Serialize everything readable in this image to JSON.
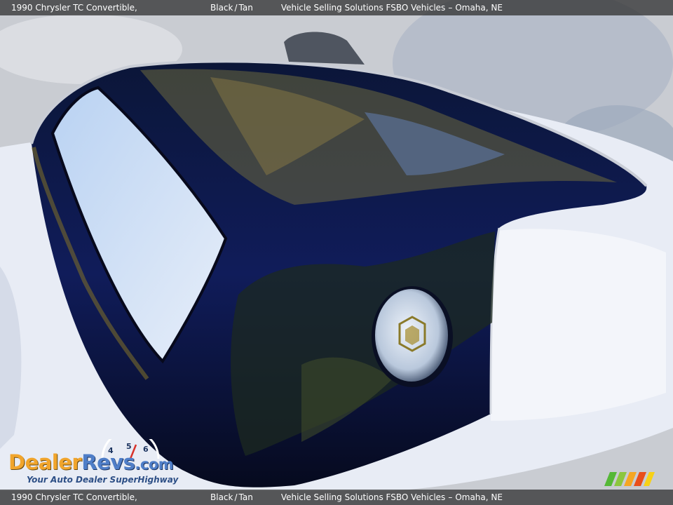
{
  "caption": {
    "vehicle": "1990 Chrysler TC Convertible,",
    "color_exterior": "Black",
    "color_separator": "/",
    "color_interior": "Tan",
    "dealer": "Vehicle Selling Solutions FSBO Vehicles",
    "dash": "–",
    "location": "Omaha, NE"
  },
  "watermark": {
    "brand_part1": "Dealer",
    "brand_part2": "Revs",
    "brand_part3": ".com",
    "tagline": "Your Auto Dealer SuperHighway",
    "speedo_digits": [
      "4",
      "5",
      "6"
    ]
  },
  "photo": {
    "subject": "hardtop-with-porthole-window",
    "colors": {
      "paint": "#0a1030",
      "cover": "#e6eaf4",
      "pavement": "#c8ccd4"
    }
  }
}
